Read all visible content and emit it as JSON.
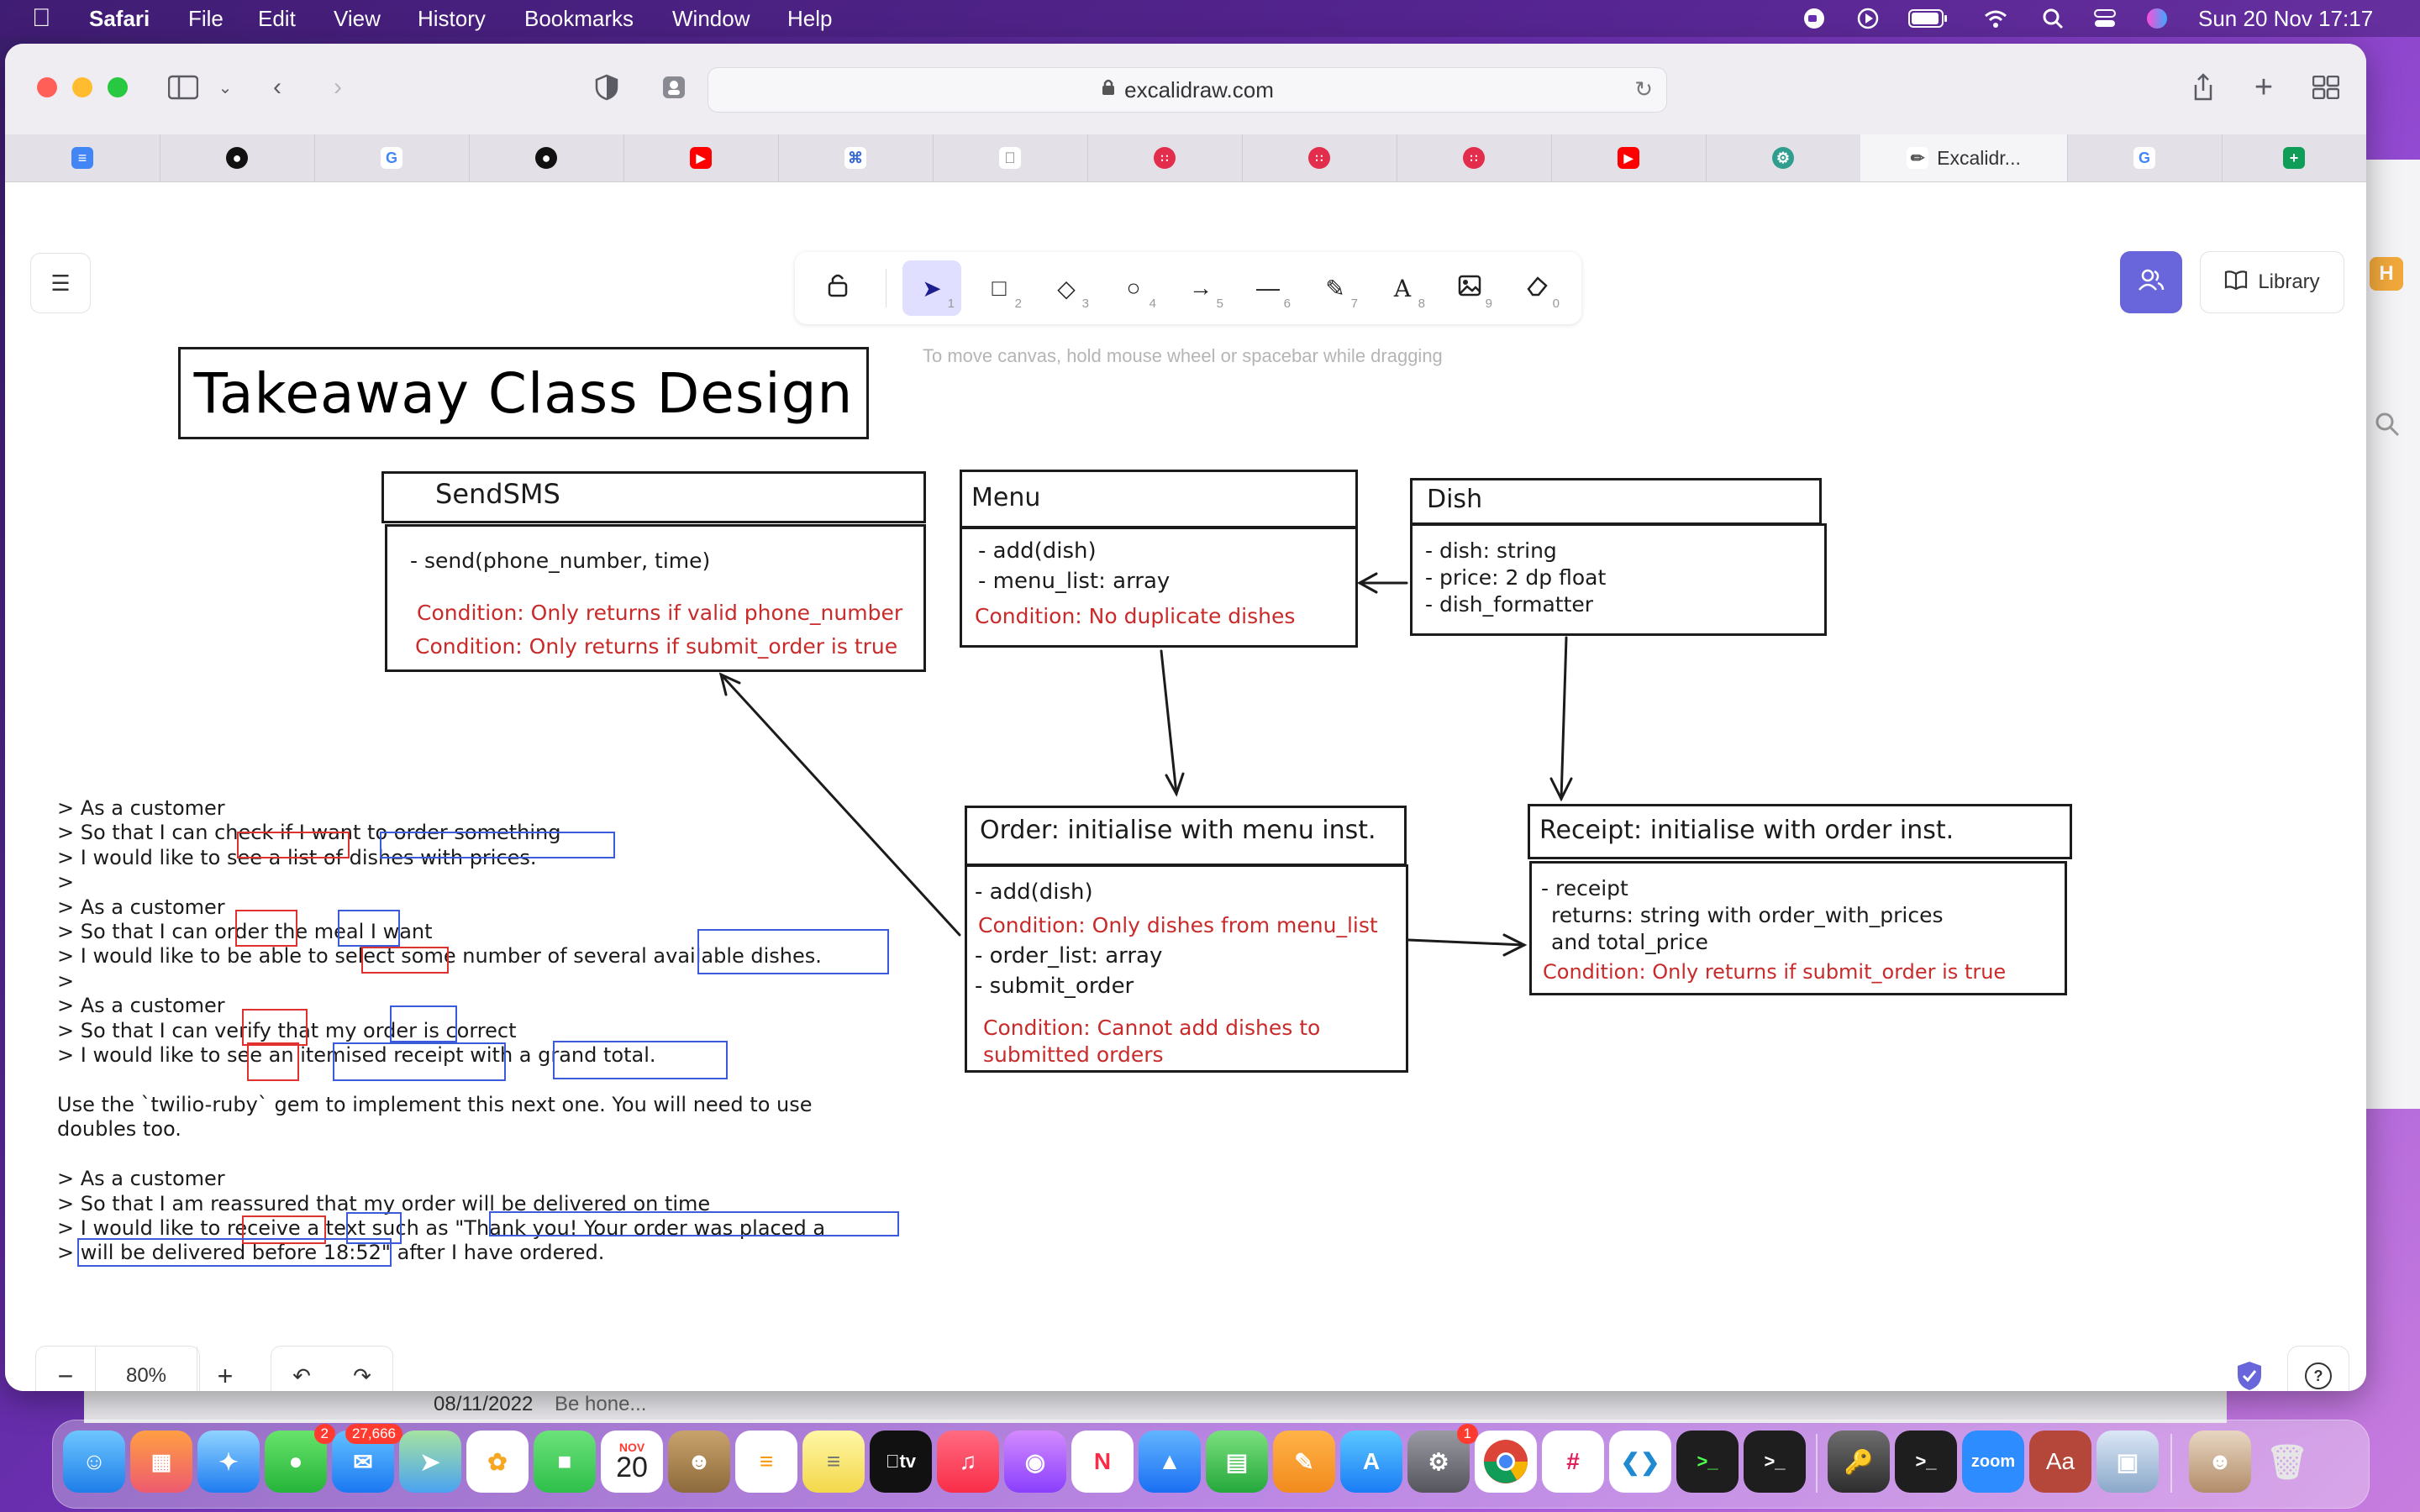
{
  "menubar": {
    "app": "Safari",
    "items": [
      "File",
      "Edit",
      "View",
      "History",
      "Bookmarks",
      "Window",
      "Help"
    ],
    "datetime": "Sun 20 Nov  17:17"
  },
  "browser": {
    "url": "excalidraw.com",
    "active_tab_title": "Excalidr...",
    "tab_icons": [
      "docs-icon",
      "github-icon",
      "google-icon",
      "github-icon",
      "youtube-icon",
      "raycast-icon",
      "apple-icon",
      "target-icon",
      "target-icon",
      "target-icon",
      "youtube-icon",
      "gear-icon",
      "excalidraw-icon",
      "google-icon",
      "sheets-icon"
    ]
  },
  "excalidraw": {
    "library_label": "Library",
    "hint": "To move canvas, hold mouse wheel or spacebar while dragging",
    "zoom": "80%",
    "tool_keys": [
      "1",
      "2",
      "3",
      "4",
      "5",
      "6",
      "7",
      "8",
      "9",
      "0"
    ]
  },
  "drawing": {
    "title": "Takeaway Class Design",
    "sendsms": {
      "name": "SendSMS",
      "method": "- send(phone_number, time)",
      "cond1": "Condition: Only returns if valid phone_number",
      "cond2": "Condition: Only returns if submit_order is true"
    },
    "menu": {
      "name": "Menu",
      "line1": "- add(dish)",
      "line2": "- menu_list: array",
      "cond": "Condition: No duplicate dishes"
    },
    "dish": {
      "name": "Dish",
      "line1": "- dish: string",
      "line2": "- price: 2 dp float",
      "line3": "- dish_formatter"
    },
    "order": {
      "name": "Order: initialise with menu inst.",
      "line1": "- add(dish)",
      "cond1": "Condition: Only dishes from menu_list",
      "line2": "- order_list: array",
      "line3": "- submit_order",
      "cond2a": "Condition: Cannot add dishes to",
      "cond2b": "submitted orders"
    },
    "receipt": {
      "name": "Receipt: initialise with order inst.",
      "line1": "- receipt",
      "line2": "returns: string with order_with_prices",
      "line3": "and total_price",
      "cond": "Condition: Only returns if submit_order is true"
    },
    "stories": [
      "> As a customer",
      "> So that I can check if I want to order something",
      "> I would like to see a list of dishes with prices.",
      ">",
      "> As a customer",
      "> So that I can order the meal I want",
      "> I would like to be able to select some number of several available dishes.",
      ">",
      "> As a customer",
      "> So that I can verify that my order is correct",
      "> I would like to see an itemised receipt with a grand total.",
      "",
      "Use the `twilio-ruby` gem to implement this next one. You will need to use",
      "doubles too.",
      "",
      "> As a customer",
      "> So that I am reassured that my order will be delivered on time",
      "> I would like to receive a text such as \"Thank you! Your order was placed a",
      "> will be delivered before 18:52\" after I have ordered."
    ]
  },
  "background_window": {
    "date": "08/11/2022",
    "snippet": "Be hone..."
  },
  "dock": {
    "messages_badge": "2",
    "mail_badge": "27,666",
    "calendar_month": "NOV",
    "calendar_day": "20",
    "settings_badge": "1",
    "zoom_label": "zoom",
    "tv_label": "tv",
    "dictionary_label": "Aa"
  }
}
